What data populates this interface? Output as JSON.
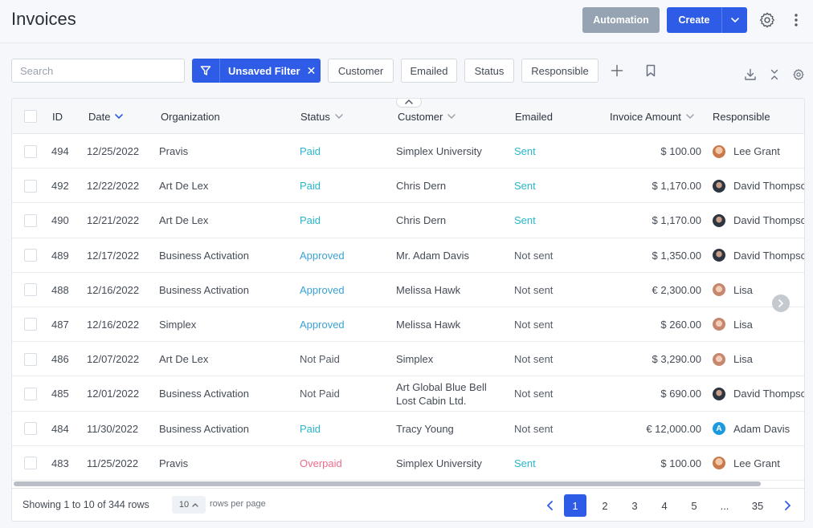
{
  "header": {
    "title": "Invoices",
    "automation_label": "Automation",
    "create_label": "Create"
  },
  "filter_bar": {
    "search_placeholder": "Search",
    "unsaved_filter_label": "Unsaved Filter",
    "close_glyph": "✕",
    "chips": [
      "Customer",
      "Emailed",
      "Status",
      "Responsible"
    ]
  },
  "table": {
    "columns": {
      "id": "ID",
      "date": "Date",
      "organization": "Organization",
      "status": "Status",
      "customer": "Customer",
      "emailed": "Emailed",
      "amount": "Invoice Amount",
      "responsible": "Responsible"
    },
    "rows": [
      {
        "id": "494",
        "date": "12/25/2022",
        "org": "Pravis",
        "status": "Paid",
        "status_kind": "paid",
        "customer": "Simplex University",
        "emailed": "Sent",
        "emailed_kind": "sent",
        "amount": "$ 100.00",
        "responsible": "Lee Grant",
        "avatar": "lee"
      },
      {
        "id": "492",
        "date": "12/22/2022",
        "org": "Art De Lex",
        "status": "Paid",
        "status_kind": "paid",
        "customer": "Chris Dern",
        "emailed": "Sent",
        "emailed_kind": "sent",
        "amount": "$ 1,170.00",
        "responsible": "David Thompson",
        "avatar": "david"
      },
      {
        "id": "490",
        "date": "12/21/2022",
        "org": "Art De Lex",
        "status": "Paid",
        "status_kind": "paid",
        "customer": "Chris Dern",
        "emailed": "Sent",
        "emailed_kind": "sent",
        "amount": "$ 1,170.00",
        "responsible": "David Thompson",
        "avatar": "david"
      },
      {
        "id": "489",
        "date": "12/17/2022",
        "org": "Business Activation",
        "status": "Approved",
        "status_kind": "approved",
        "customer": "Mr. Adam Davis",
        "emailed": "Not sent",
        "emailed_kind": "not",
        "amount": "$ 1,350.00",
        "responsible": "David Thompson",
        "avatar": "david"
      },
      {
        "id": "488",
        "date": "12/16/2022",
        "org": "Business Activation",
        "status": "Approved",
        "status_kind": "approved",
        "customer": "Melissa Hawk",
        "emailed": "Not sent",
        "emailed_kind": "not",
        "amount": "€ 2,300.00",
        "responsible": "Lisa",
        "avatar": "lisa"
      },
      {
        "id": "487",
        "date": "12/16/2022",
        "org": "Simplex",
        "status": "Approved",
        "status_kind": "approved",
        "customer": "Melissa Hawk",
        "emailed": "Not sent",
        "emailed_kind": "not",
        "amount": "$ 260.00",
        "responsible": "Lisa",
        "avatar": "lisa"
      },
      {
        "id": "486",
        "date": "12/07/2022",
        "org": "Art De Lex",
        "status": "Not Paid",
        "status_kind": "notpaid",
        "customer": "Simplex",
        "emailed": "Not sent",
        "emailed_kind": "not",
        "amount": "$ 3,290.00",
        "responsible": "Lisa",
        "avatar": "lisa"
      },
      {
        "id": "485",
        "date": "12/01/2022",
        "org": "Business Activation",
        "status": "Not Paid",
        "status_kind": "notpaid",
        "customer": "Art Global Blue Bell Lost Cabin Ltd.",
        "emailed": "Not sent",
        "emailed_kind": "not",
        "amount": "$ 690.00",
        "responsible": "David Thompson",
        "avatar": "david"
      },
      {
        "id": "484",
        "date": "11/30/2022",
        "org": "Business Activation",
        "status": "Paid",
        "status_kind": "paid",
        "customer": "Tracy Young",
        "emailed": "Not sent",
        "emailed_kind": "not",
        "amount": "€ 12,000.00",
        "responsible": "Adam Davis",
        "avatar": "adam",
        "avatar_letter": "A"
      },
      {
        "id": "483",
        "date": "11/25/2022",
        "org": "Pravis",
        "status": "Overpaid",
        "status_kind": "overpaid",
        "customer": "Simplex University",
        "emailed": "Sent",
        "emailed_kind": "sent",
        "amount": "$ 100.00",
        "responsible": "Lee Grant",
        "avatar": "lee"
      }
    ]
  },
  "footer": {
    "showing": "Showing 1 to 10 of 344 rows",
    "rows_per_page_value": "10",
    "rows_per_page_label": "rows per page",
    "pages": [
      "1",
      "2",
      "3",
      "4",
      "5",
      "...",
      "35"
    ],
    "current_page": "1"
  },
  "colors": {
    "primary": "#2f5ce6",
    "automation": "#96a3b3",
    "paid": "#29b6c9",
    "approved": "#3aa2d4",
    "overpaid": "#ef6b8a"
  }
}
